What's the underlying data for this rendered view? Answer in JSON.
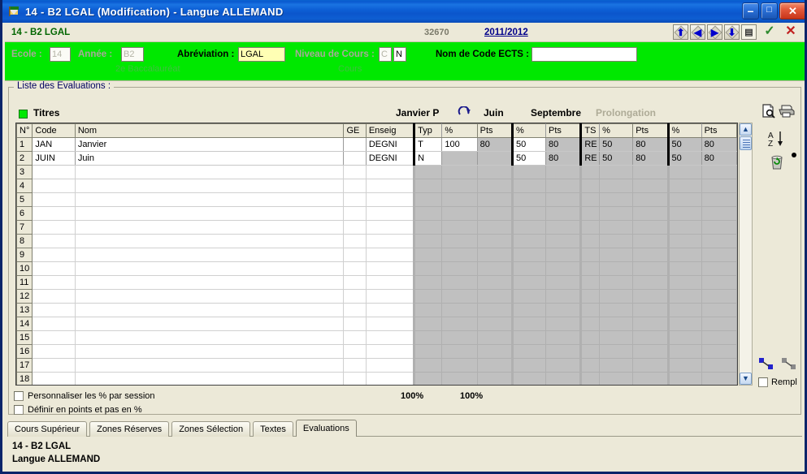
{
  "window": {
    "title": "14 - B2   LGAL  (Modification) - Langue ALLEMAND",
    "icon": "app-flag-icon",
    "minimize": "–",
    "maximize": "□",
    "close": "✕"
  },
  "record_bar": {
    "title": "14 - B2   LGAL",
    "record_number": "32670",
    "year_link": "2011/2012",
    "nav": [
      {
        "name": "first-record",
        "glyph": "⬆"
      },
      {
        "name": "previous-record",
        "glyph": "◀"
      },
      {
        "name": "next-record",
        "glyph": "▶"
      },
      {
        "name": "last-record",
        "glyph": "⬇"
      },
      {
        "name": "record-list",
        "glyph": "▤"
      }
    ],
    "ok_glyph": "✓",
    "cancel_glyph": "✕"
  },
  "form": {
    "ecole_label": "Ecole :",
    "ecole_value": "14",
    "annee_label": "Année :",
    "annee_value": "B2",
    "annee_sub": "2e Baccalauréat",
    "abreviation_label": "Abréviation :",
    "abreviation_value": "LGAL",
    "niveau_label": "Niveau de Cours :",
    "niveau_c": "C",
    "niveau_n": "N",
    "niveau_sub": "Cours",
    "ects_label": "Nom de Code ECTS :",
    "ects_value": ""
  },
  "group": {
    "legend": "Liste des Evaluations :",
    "titres_label": "Titres",
    "refresh_icon": "refresh-icon",
    "sessions": [
      {
        "label": "Janvier P",
        "dim": false
      },
      {
        "label": "Juin",
        "dim": false
      },
      {
        "label": "Septembre",
        "dim": false
      },
      {
        "label": "Prolongation",
        "dim": true
      }
    ]
  },
  "grid": {
    "columns": [
      "N°",
      "Code",
      "Nom",
      "GE",
      "Enseig",
      "Typ",
      "%",
      "Pts",
      "%",
      "Pts",
      "TS",
      "%",
      "Pts",
      "%",
      "Pts"
    ],
    "rows": [
      {
        "n": "1",
        "code": "JAN",
        "nom": "Janvier",
        "ge": "",
        "enseig": "DEGNI",
        "typ": "T",
        "jan_pct": "100",
        "jan_pts": "80",
        "jun_pct": "50",
        "jun_pts": "80",
        "sep_ts": "RE",
        "sep_pct": "50",
        "sep_pts": "80",
        "pro_pct": "50",
        "pro_pts": "80"
      },
      {
        "n": "2",
        "code": "JUIN",
        "nom": "Juin",
        "ge": "",
        "enseig": "DEGNI",
        "typ": "N",
        "jan_pct": "",
        "jan_pts": "",
        "jun_pct": "50",
        "jun_pts": "80",
        "sep_ts": "RE",
        "sep_pct": "50",
        "sep_pts": "80",
        "pro_pct": "50",
        "pro_pts": "80"
      }
    ],
    "empty_row_numbers": [
      "3",
      "4",
      "5",
      "6",
      "7",
      "8",
      "9",
      "10",
      "11",
      "12",
      "13",
      "14",
      "15",
      "16",
      "17",
      "18"
    ]
  },
  "tools": {
    "preview": "preview-icon",
    "print": "print-icon",
    "sort": "sort-az-icon",
    "trash": "trash-icon",
    "dot": "bullet-dot-icon",
    "link_blue": "link-blue-icon",
    "link_gray": "link-gray-icon",
    "rempl_label": "Rempl"
  },
  "options": {
    "personnaliser_label": "Personnaliser les % par session",
    "definir_label": "Définir en points et pas en %",
    "total_janvier": "100%",
    "total_juin": "100%"
  },
  "tabs": [
    {
      "label": "Cours Supérieur",
      "active": false
    },
    {
      "label": "Zones Réserves",
      "active": false
    },
    {
      "label": "Zones Sélection",
      "active": false
    },
    {
      "label": "Textes",
      "active": false
    },
    {
      "label": "Evaluations",
      "active": true
    }
  ],
  "status": {
    "line1": "14 - B2   LGAL",
    "line2": "Langue ALLEMAND"
  },
  "colors": {
    "title_bar": "#0a5ad0",
    "form_green": "#00e800",
    "chrome": "#ece9d8",
    "link": "#00008b",
    "record_title": "#006600"
  }
}
